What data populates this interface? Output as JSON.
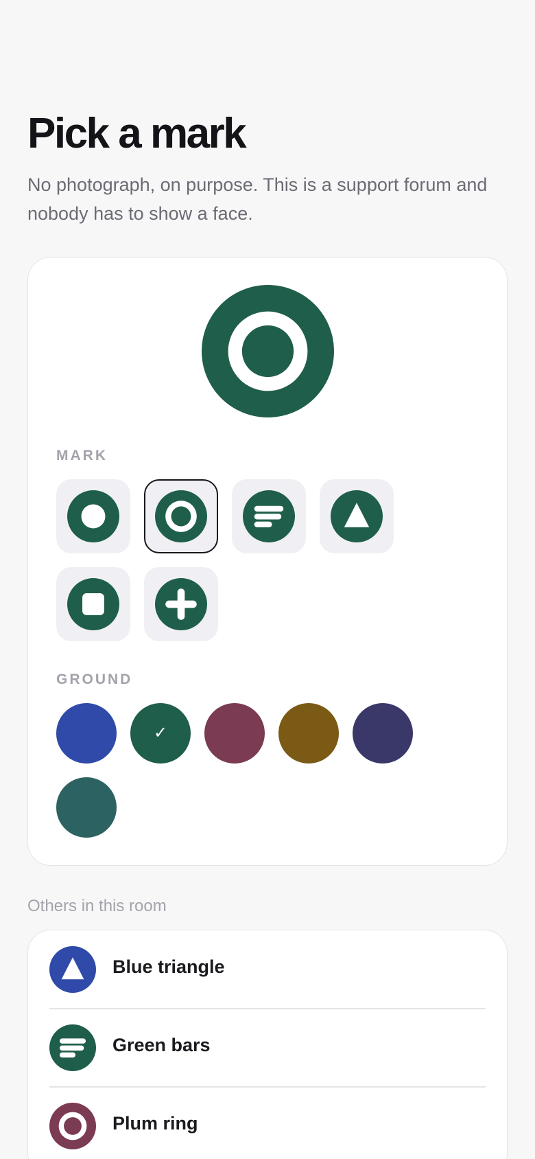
{
  "header": {
    "title": "Pick a mark",
    "subtitle": "No photograph, on purpose. This is a support forum and nobody has to show a face."
  },
  "editor": {
    "preview": {
      "mark": "ring",
      "ground": "#1f5e4a"
    },
    "mark_label": "MARK",
    "ground_label": "GROUND",
    "marks": [
      {
        "icon": "dot-icon",
        "selected": false
      },
      {
        "icon": "ring-icon",
        "selected": true
      },
      {
        "icon": "bars-icon",
        "selected": false
      },
      {
        "icon": "triangle-icon",
        "selected": false
      },
      {
        "icon": "square-icon",
        "selected": false
      },
      {
        "icon": "plus-icon",
        "selected": false
      }
    ],
    "grounds": [
      {
        "color": "#2f4aa8",
        "selected": false
      },
      {
        "color": "#1f5e4a",
        "selected": true,
        "check": "✓"
      },
      {
        "color": "#7b3b52",
        "selected": false
      },
      {
        "color": "#7a5a14",
        "selected": false
      },
      {
        "color": "#3a3868",
        "selected": false
      },
      {
        "color": "#2c6262",
        "selected": false
      }
    ]
  },
  "others": {
    "label": "Others in this room",
    "members": [
      {
        "name": "Blue triangle",
        "icon": "triangle-icon",
        "color": "#2f4aa8"
      },
      {
        "name": "Green bars",
        "icon": "bars-icon",
        "color": "#1f5e4a"
      },
      {
        "name": "Plum ring",
        "icon": "ring-icon",
        "color": "#7b3b52"
      }
    ]
  },
  "colors": {
    "accent": "#1f5e4a",
    "background": "#f7f7f8",
    "card": "#ffffff"
  }
}
